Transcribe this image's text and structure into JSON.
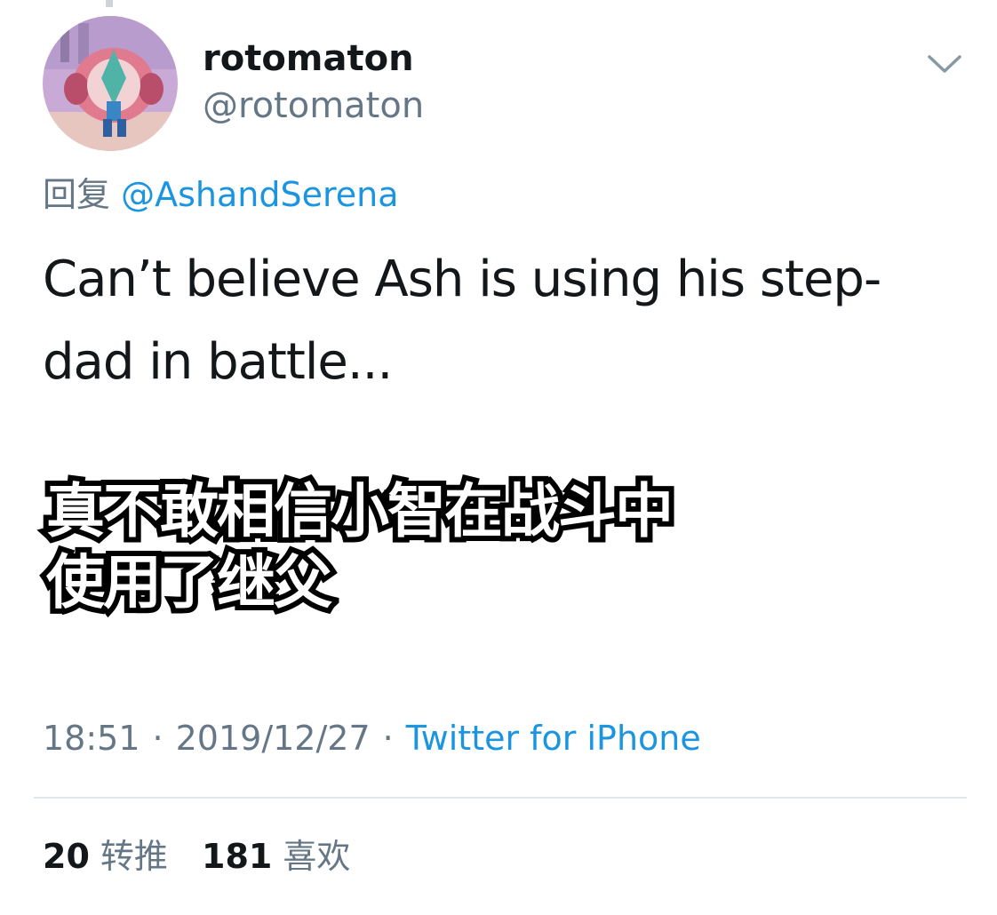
{
  "author": {
    "display_name": "rotomaton",
    "handle": "@rotomaton"
  },
  "reply": {
    "prefix": "回复",
    "to_handle": "@AshandSerena"
  },
  "tweet": {
    "text_lines": [
      "Can’t believe Ash is using his step-",
      "dad in battle..."
    ]
  },
  "caption": {
    "lines": [
      "真不敢相信小智在战斗中",
      "使用了继父"
    ]
  },
  "meta": {
    "time": "18:51",
    "date": "2019/12/27",
    "source": "Twitter for iPhone",
    "separator": "·"
  },
  "stats": {
    "retweets": {
      "count": "20",
      "label": "转推"
    },
    "likes": {
      "count": "181",
      "label": "喜欢"
    }
  },
  "icons": {
    "menu": "chevron-down-icon",
    "avatar": "avatar-image"
  },
  "colors": {
    "link": "#1b95e0",
    "secondary_text": "#657786",
    "primary_text": "#14171a",
    "divider": "#e1e8ed"
  }
}
